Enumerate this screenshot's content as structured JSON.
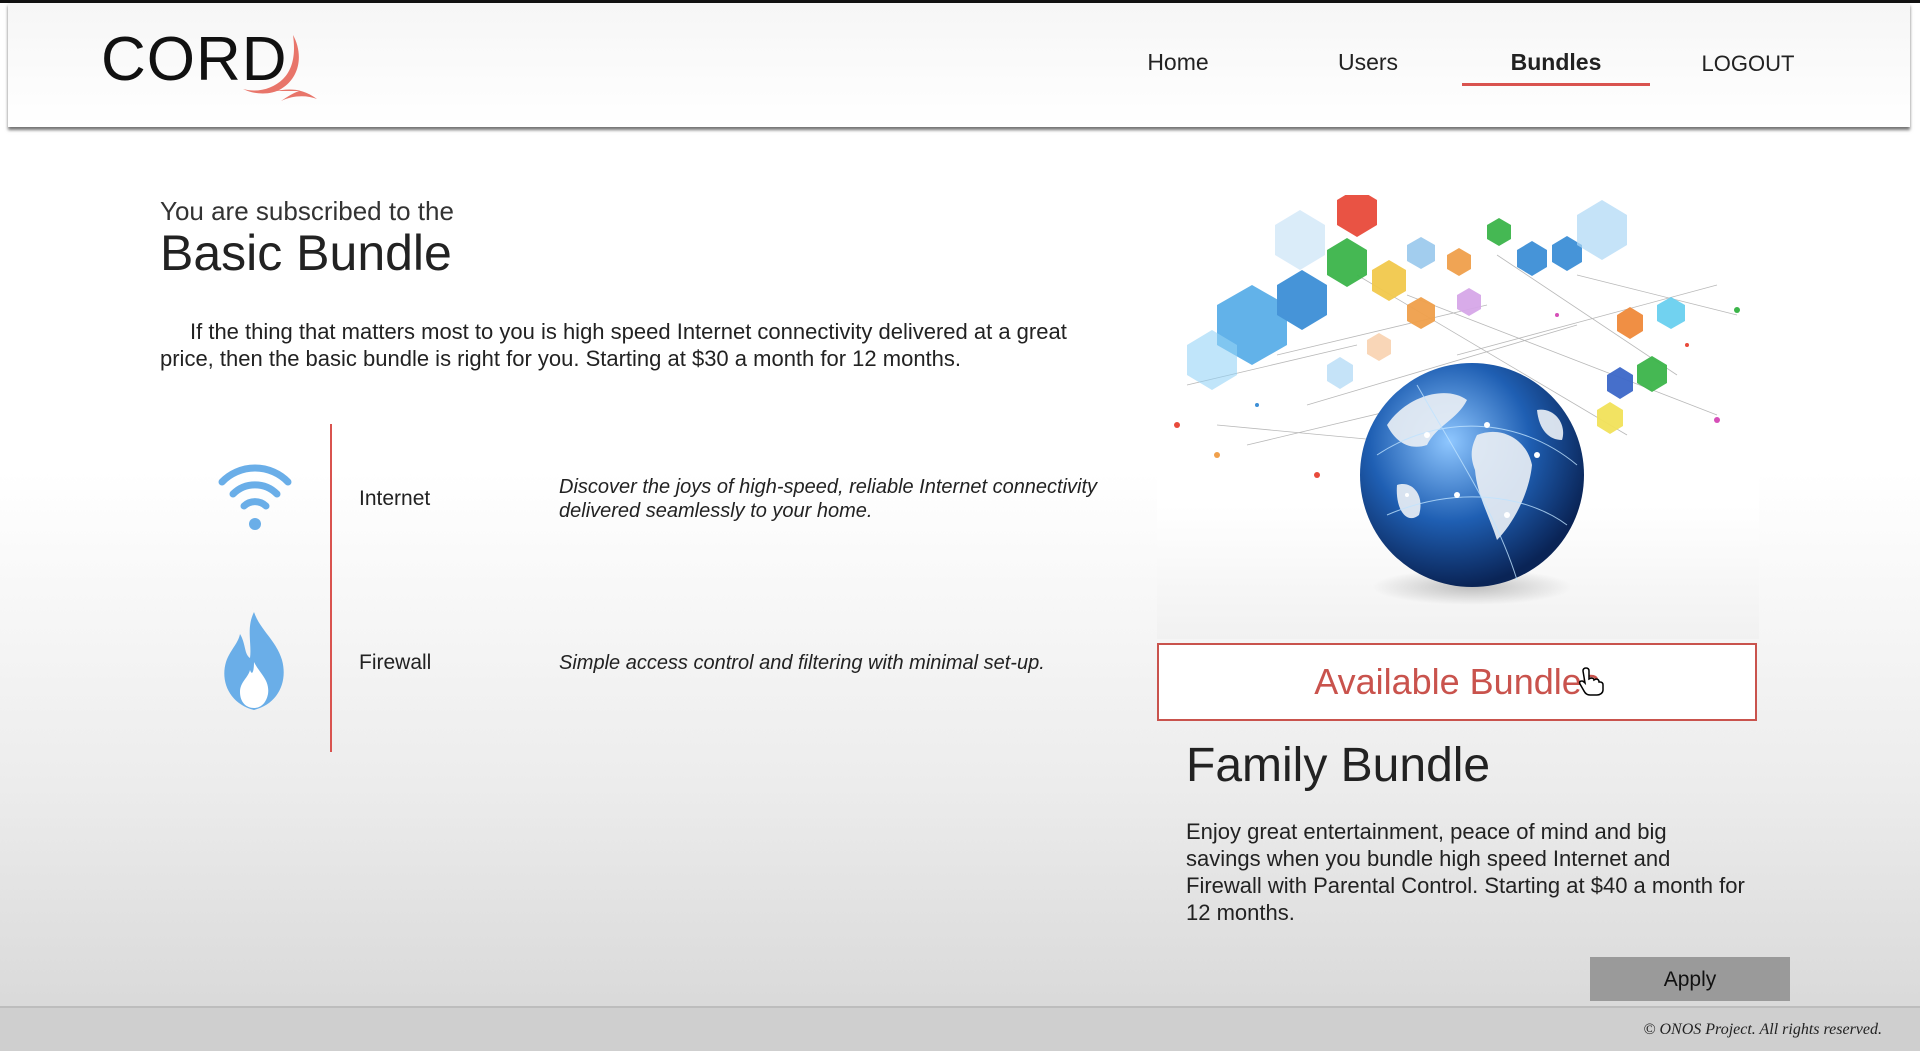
{
  "header": {
    "logo_text": "CORD",
    "nav": [
      {
        "label": "Home",
        "active": false
      },
      {
        "label": "Users",
        "active": false
      },
      {
        "label": "Bundles",
        "active": true
      },
      {
        "label": "LOGOUT",
        "active": false
      }
    ]
  },
  "subscription": {
    "intro": "You are subscribed to the",
    "bundle_name": "Basic Bundle",
    "description": "If the thing that matters most to you is high speed Internet connectivity delivered at a great price, then the basic bundle is right for you. Starting at $30 a month for 12 months."
  },
  "features": [
    {
      "name": "Internet",
      "icon": "wifi-icon",
      "description": "Discover the joys of high-speed, reliable Internet connectivity delivered seamlessly to your home."
    },
    {
      "name": "Firewall",
      "icon": "flame-icon",
      "description": "Simple access control and filtering with minimal set-up."
    }
  ],
  "available": {
    "button_label": "Available Bundles",
    "bundle_title": "Family Bundle",
    "bundle_description": "Enjoy great entertainment, peace of mind and big savings when you bundle high speed Internet and Firewall with Parental Control. Starting at $40 a month for 12 months.",
    "apply_label": "Apply"
  },
  "footer": {
    "copyright": "© ONOS Project. All rights reserved."
  },
  "colors": {
    "accent": "#c9534d",
    "icon_blue": "#6aaee8",
    "apply_bg": "#9a9a9a"
  }
}
